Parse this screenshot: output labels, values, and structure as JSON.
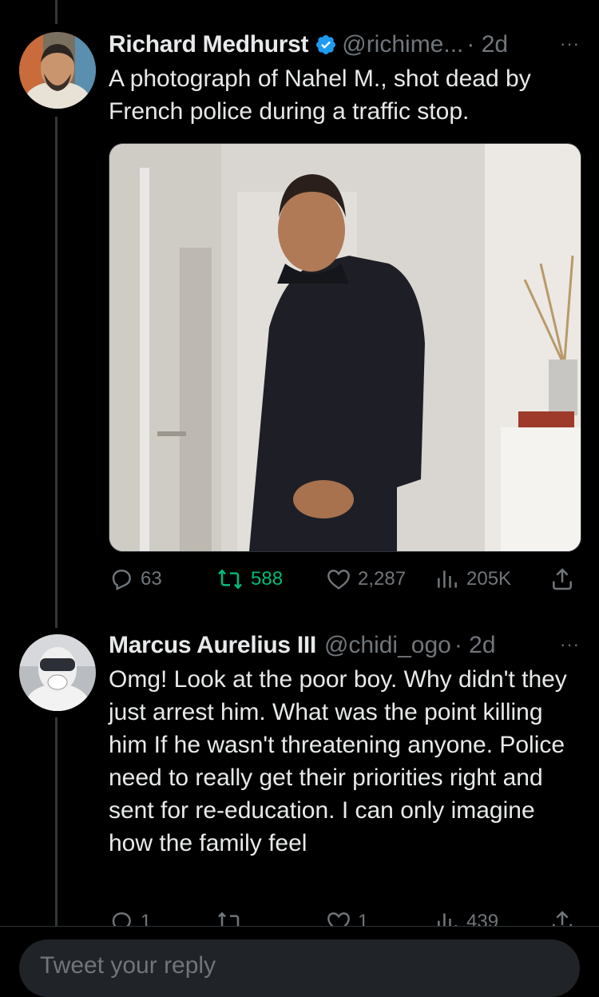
{
  "tweets": [
    {
      "name": "Richard Medhurst",
      "handle": "@richime...",
      "time": "· 2d",
      "more": "···",
      "text": "A photograph of Nahel M., shot dead by French police during a traffic stop.",
      "verified": true,
      "stats": {
        "replies": "63",
        "retweets": "588",
        "likes": "2,287",
        "views": "205K"
      }
    },
    {
      "name": "Marcus Aurelius III",
      "handle": "@chidi_ogo",
      "time": "· 2d",
      "more": "···",
      "text": "Omg! Look at the poor boy. Why didn't they just arrest him. What was the point killing him If he wasn't threatening anyone. Police need to really get their priorities right and sent for re-education. I can only imagine how the family feel",
      "verified": false,
      "stats": {
        "replies": "1",
        "retweets": "",
        "likes": "1",
        "views": "439"
      }
    }
  ],
  "reply": {
    "placeholder": "Tweet your reply"
  },
  "colors": {
    "background": "#000000",
    "text": "#e7e9ea",
    "muted": "#71767b",
    "accent": "#1d9bf0",
    "retweet": "#00ba7c"
  },
  "icons": [
    "verified-badge-icon",
    "more-icon",
    "reply-icon",
    "retweet-icon",
    "like-icon",
    "views-icon",
    "share-icon"
  ]
}
